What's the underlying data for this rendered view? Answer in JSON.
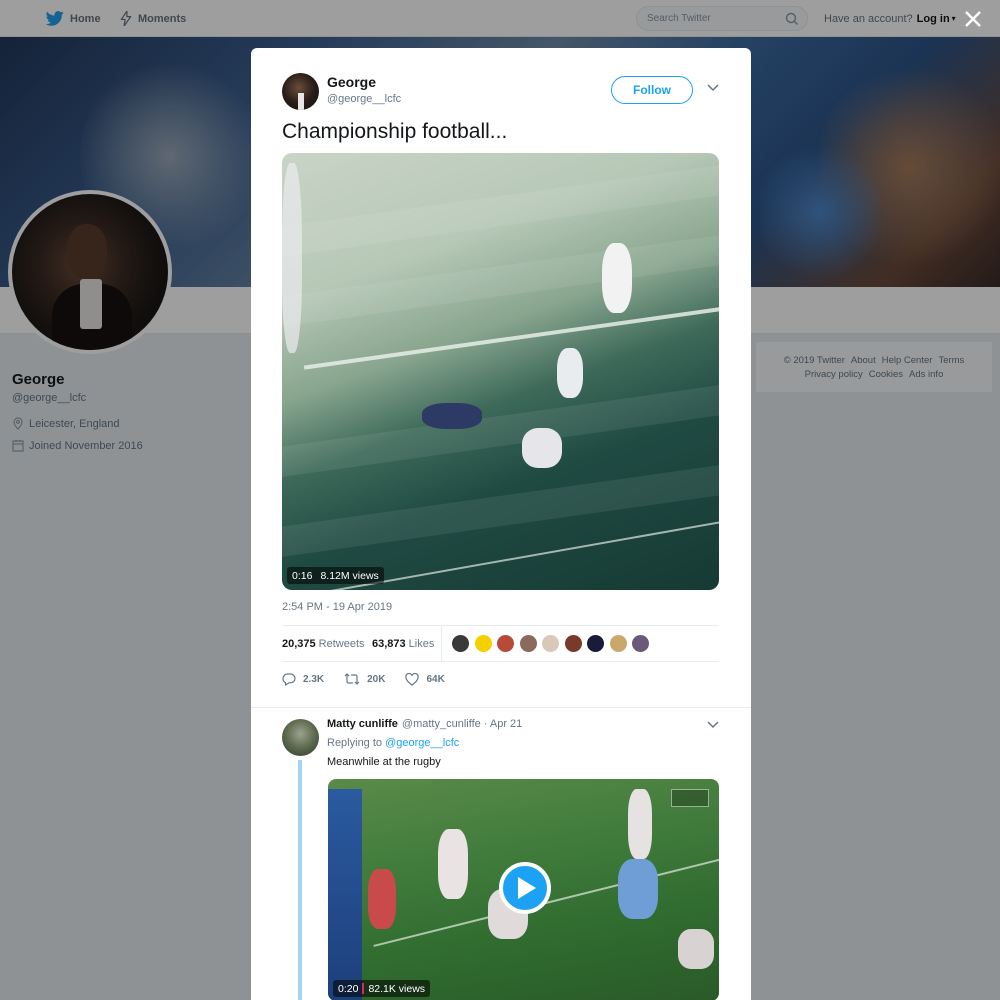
{
  "topnav": {
    "home_label": "Home",
    "moments_label": "Moments",
    "search_placeholder": "Search Twitter",
    "have_account": "Have an account?",
    "login_label": "Log in"
  },
  "profile": {
    "name": "George",
    "handle": "@george__lcfc",
    "location": "Leicester, England",
    "joined": "Joined November 2016"
  },
  "footer": {
    "links": [
      "© 2019 Twitter",
      "About",
      "Help Center",
      "Terms",
      "Privacy policy",
      "Cookies",
      "Ads info"
    ]
  },
  "tweet": {
    "author_name": "George",
    "author_handle": "@george__lcfc",
    "follow_label": "Follow",
    "text": "Championship football...",
    "video_duration": "0:16",
    "video_views": "8.12M views",
    "timestamp": "2:54 PM - 19 Apr 2019",
    "retweets_count": "20,375",
    "retweets_label": "Retweets",
    "likes_count": "63,873",
    "likes_label": "Likes",
    "reply_count": "2.3K",
    "retweet_action_count": "20K",
    "like_action_count": "64K",
    "liker_colors": [
      "#3a3a3a",
      "#f5d000",
      "#b84a3a",
      "#8a6a5a",
      "#d9c7b8",
      "#7a3a2a",
      "#1a1a3a",
      "#c9a86a",
      "#6a5a7a"
    ]
  },
  "reply": {
    "author_name": "Matty cunliffe",
    "author_handle": "@matty_cunliffe",
    "date": "· Apr 21",
    "replying_prefix": "Replying to",
    "replying_to": "@george__lcfc",
    "text": "Meanwhile at the rugby",
    "video_duration": "0:20",
    "video_views": "82.1K views"
  },
  "colors": {
    "accent": "#1da1f2",
    "thread_line": "#a4d4f5"
  }
}
